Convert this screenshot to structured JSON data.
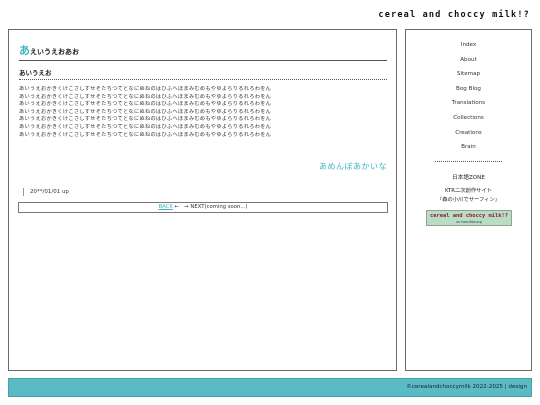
{
  "site": {
    "title": "cereal and choccy milk!?"
  },
  "main": {
    "title_initial": "あ",
    "title_rest": "えいうえおあお",
    "section_heading": "あいうえお",
    "body_lines": [
      "あいうえおかきくけこさしすせそたちつてとなにぬねのはひふへほまみむめもやゆよらりるれろわをん",
      "あいうえおかきくけこさしすせそたちつてとなにぬねのはひふへほまみむめもやゆよらりるれろわをん",
      "あいうえおかきくけこさしすせそたちつてとなにぬねのはひふへほまみむめもやゆよらりるれろわをん",
      "あいうえおかきくけこさしすせそたちつてとなにぬねのはひふへほまみむめもやゆよらりるれろわをん",
      "あいうえおかきくけこさしすせそたちつてとなにぬねのはひふへほまみむめもやゆよらりるれろわをん",
      "あいうえおかきくけこさしすせそたちつてとなにぬねのはひふへほまみむめもやゆよらりるれろわをん",
      "あいうえおかきくけこさしすせそたちつてとなにぬねのはひふへほまみむめもやゆよらりるれろわをん"
    ],
    "aside_title": "あめんぼあかいな",
    "post_date": "20**/01/01 up",
    "pager": {
      "back": "BACK",
      "arrow": "←　→",
      "next": "NEXT(coming soon...)"
    }
  },
  "sidebar": {
    "nav": [
      "Index",
      "About",
      "Sitemap",
      "Bog Blog",
      "Translations",
      "Collections",
      "Creations",
      "Brain"
    ],
    "zone": "日本語ZONE",
    "link_line1": "KTR二次創作サイト",
    "link_line2": "『森の小川でサーフィン』",
    "banner_main": "cereal and choccy milk!?",
    "banner_sub": "on neocities.org"
  },
  "footer": {
    "text": "©cerealandchoccymilk 2022-2025 | design"
  },
  "colors": {
    "accent": "#3bb4c1",
    "footer_bg": "#5bbbc5",
    "banner_bg": "#b9dcc2"
  }
}
